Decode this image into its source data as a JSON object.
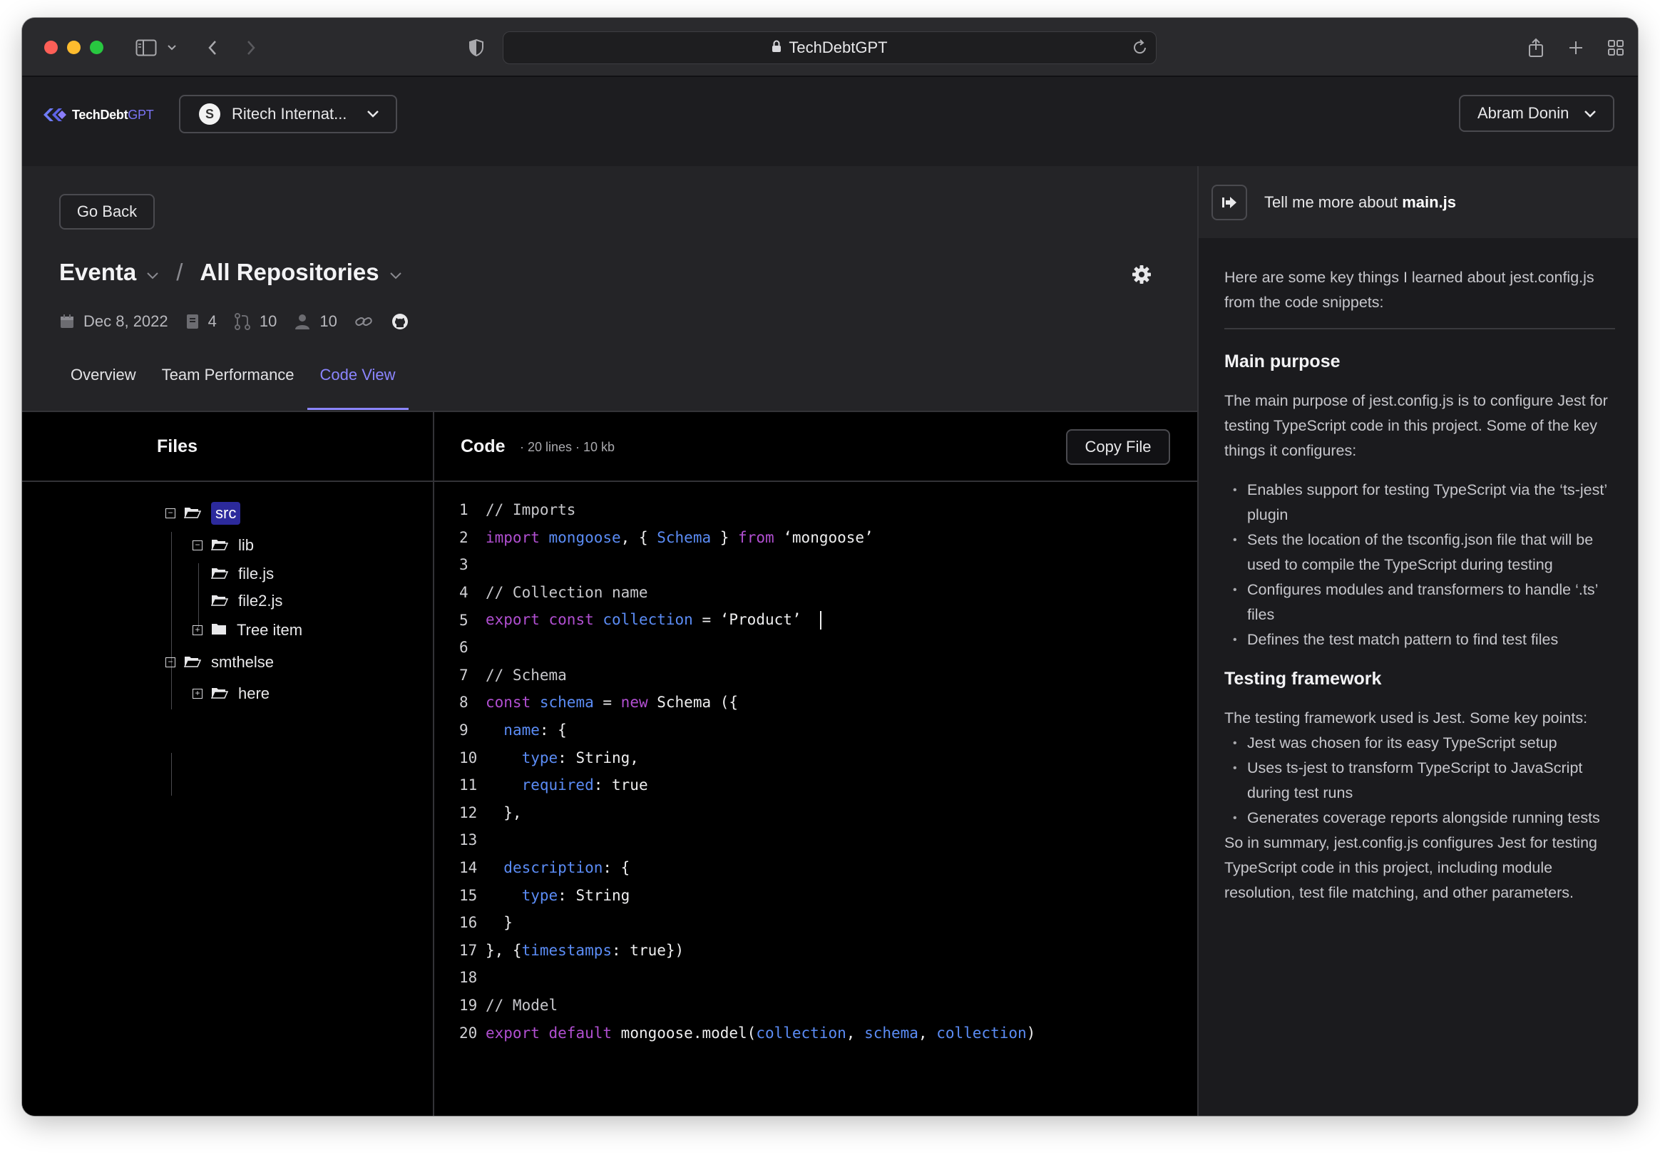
{
  "browser": {
    "url": "TechDebtGPT"
  },
  "header": {
    "logo_main": "TechDebt",
    "logo_accent": "GPT",
    "org_badge": "S",
    "org_name": "Ritech Internat...",
    "user_name": "Abram Donin"
  },
  "main": {
    "go_back_label": "Go Back",
    "project": "Eventa",
    "separator": "/",
    "repo_scope": "All Repositories",
    "meta": {
      "date": "Dec 8, 2022",
      "docs_count": "4",
      "pr_count": "10",
      "users_count": "10"
    },
    "tabs": [
      "Overview",
      "Team Performance",
      "Code View"
    ],
    "active_tab": "Code View"
  },
  "files": {
    "title": "Files",
    "tree": [
      {
        "label": "src",
        "level": 0,
        "type": "folder-open",
        "toggle": "minus",
        "selected": true
      },
      {
        "label": "lib",
        "level": 1,
        "type": "folder-open",
        "toggle": "minus"
      },
      {
        "label": "file.js",
        "level": 2,
        "type": "folder-open"
      },
      {
        "label": "file2.js",
        "level": 2,
        "type": "folder-open"
      },
      {
        "label": "Tree item",
        "level": 1,
        "type": "folder",
        "toggle": "plus"
      },
      {
        "label": "smthelse",
        "level": 0,
        "type": "folder-open",
        "toggle": "minus"
      },
      {
        "label": "here",
        "level": 1,
        "type": "folder-open",
        "toggle": "plus"
      }
    ]
  },
  "code": {
    "title": "Code",
    "meta": "· 20 lines · 10 kb",
    "copy_label": "Copy File",
    "lines": [
      [
        [
          "cm",
          "// Imports"
        ]
      ],
      [
        [
          "kw",
          "import"
        ],
        [
          "tx",
          " "
        ],
        [
          "id",
          "mongoose"
        ],
        [
          "tx",
          ", { "
        ],
        [
          "id",
          "Schema"
        ],
        [
          "tx",
          " } "
        ],
        [
          "kw",
          "from"
        ],
        [
          "tx",
          " ‘mongoose’"
        ]
      ],
      [],
      [
        [
          "cm",
          "// Collection name"
        ]
      ],
      [
        [
          "kw",
          "export"
        ],
        [
          "tx",
          " "
        ],
        [
          "kw",
          "const"
        ],
        [
          "tx",
          " "
        ],
        [
          "id",
          "collection"
        ],
        [
          "tx",
          " = ‘Product’ "
        ]
      ],
      [],
      [
        [
          "cm",
          "// Schema"
        ]
      ],
      [
        [
          "kw",
          "const"
        ],
        [
          "tx",
          " "
        ],
        [
          "id",
          "schema"
        ],
        [
          "tx",
          " = "
        ],
        [
          "kw",
          "new"
        ],
        [
          "tx",
          " Schema ({"
        ]
      ],
      [
        [
          "tx",
          "  "
        ],
        [
          "id",
          "name"
        ],
        [
          "tx",
          ": {"
        ]
      ],
      [
        [
          "tx",
          "    "
        ],
        [
          "id",
          "type"
        ],
        [
          "tx",
          ": String,"
        ]
      ],
      [
        [
          "tx",
          "    "
        ],
        [
          "id",
          "required"
        ],
        [
          "tx",
          ": true"
        ]
      ],
      [
        [
          "tx",
          "  },"
        ]
      ],
      [],
      [
        [
          "tx",
          "  "
        ],
        [
          "id",
          "description"
        ],
        [
          "tx",
          ": {"
        ]
      ],
      [
        [
          "tx",
          "    "
        ],
        [
          "id",
          "type"
        ],
        [
          "tx",
          ": String"
        ]
      ],
      [
        [
          "tx",
          "  }"
        ]
      ],
      [
        [
          "tx",
          "}, {"
        ],
        [
          "id",
          "timestamps"
        ],
        [
          "tx",
          ": true})"
        ]
      ],
      [],
      [
        [
          "cm",
          "// Model"
        ]
      ],
      [
        [
          "kw",
          "export"
        ],
        [
          "tx",
          " "
        ],
        [
          "kw",
          "default"
        ],
        [
          "tx",
          " mongoose.model("
        ],
        [
          "id",
          "collection"
        ],
        [
          "tx",
          ", "
        ],
        [
          "id",
          "schema"
        ],
        [
          "tx",
          ", "
        ],
        [
          "id",
          "collection"
        ],
        [
          "tx",
          ")"
        ]
      ]
    ]
  },
  "chat": {
    "question_prefix": "Tell me more about ",
    "question_file": "main.js",
    "intro": "Here are some key things I learned about jest.config.js from the code snippets:",
    "section1_title": "Main purpose",
    "section1_text": "The main purpose of jest.config.js is to configure Jest for testing TypeScript code in this project. Some of the key things it configures:",
    "section1_bullets": [
      "Enables support for testing TypeScript via the ‘ts-jest’ plugin",
      "Sets the location of the tsconfig.json file that will be used to compile the TypeScript during testing",
      "Configures modules and transformers to handle ‘.ts’ files",
      "Defines the test match pattern to find test files"
    ],
    "section2_title": "Testing framework",
    "section2_text": "The testing framework used is Jest. Some key points:",
    "section2_bullets": [
      "Jest was chosen for its easy TypeScript setup",
      "Uses ts-jest to transform TypeScript to JavaScript during test runs",
      "Generates coverage reports alongside running tests"
    ],
    "summary": "So in summary, jest.config.js configures Jest for testing TypeScript code in this project, including module resolution, test file matching, and other parameters."
  }
}
